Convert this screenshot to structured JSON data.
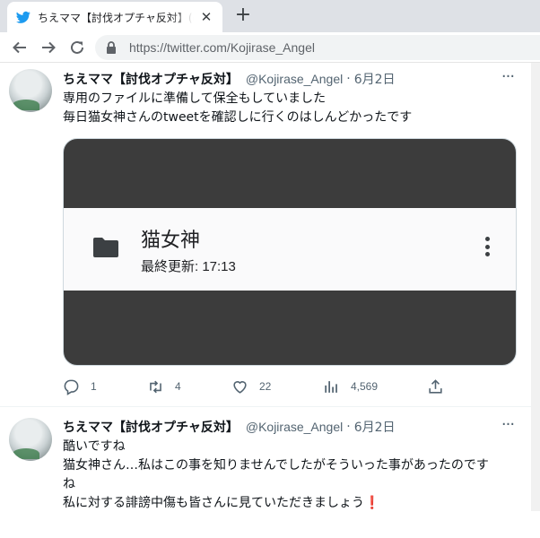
{
  "browser": {
    "tab_title": "ちえママ【討伐オプチャ反対】(@Kojirase_Angel) / Twitter",
    "tab_close_icon": "close-icon",
    "new_tab_icon": "plus-icon",
    "url": "https://twitter.com/Kojirase_Angel",
    "colors": {
      "tabbar": "#dee1e6",
      "twitter_blue": "#1d9bf0"
    }
  },
  "tweets": [
    {
      "display_name": "ちえママ【討伐オプチャ反対】",
      "handle": "@Kojirase_Angel",
      "separator": "·",
      "date": "6月2日",
      "more": "···",
      "lines": [
        "専用のファイルに準備して保全もしていました",
        "毎日猫女神さんのtweetを確認しに行くのはしんどかったです"
      ],
      "media": {
        "file_name": "猫女神",
        "file_meta": "最終更新: 17:13",
        "folder_icon": "folder-icon",
        "menu_icon": "more-vert-icon"
      },
      "actions": {
        "reply": "1",
        "retweet": "4",
        "like": "22",
        "views": "4,569"
      }
    },
    {
      "display_name": "ちえママ【討伐オプチャ反対】",
      "handle": "@Kojirase_Angel",
      "separator": "·",
      "date": "6月2日",
      "more": "···",
      "lines": [
        "酷いですね",
        "猫女神さん…私はこの事を知りませんでしたがそういった事があったのです",
        "ね",
        "私に対する誹謗中傷も皆さんに見ていただきましょう"
      ],
      "emoji": "❗"
    }
  ]
}
